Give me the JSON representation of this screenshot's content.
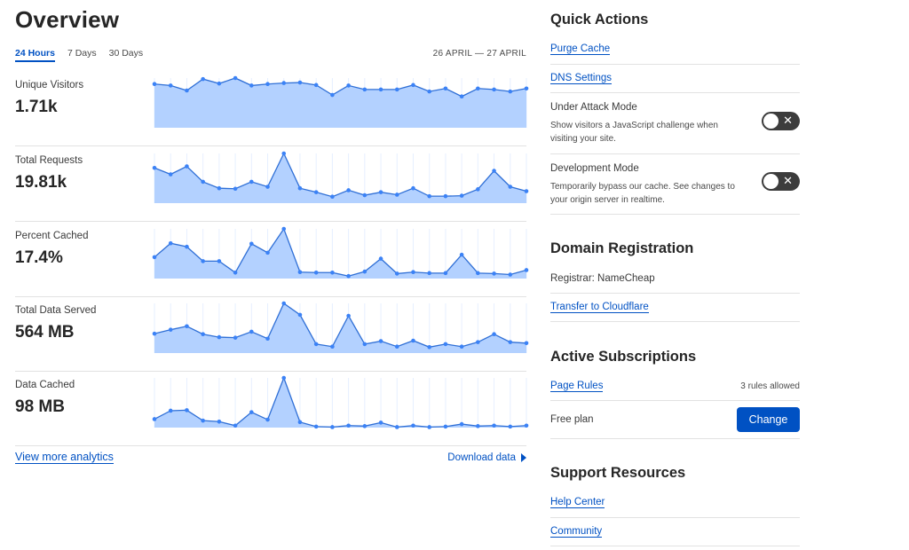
{
  "overview": {
    "title": "Overview",
    "tabs": [
      {
        "label": "24 Hours",
        "active": true
      },
      {
        "label": "7 Days",
        "active": false
      },
      {
        "label": "30 Days",
        "active": false
      }
    ],
    "date_range": "26 APRIL — 27 APRIL",
    "metrics": [
      {
        "label": "Unique Visitors",
        "value": "1.71k"
      },
      {
        "label": "Total Requests",
        "value": "19.81k"
      },
      {
        "label": "Percent Cached",
        "value": "17.4%"
      },
      {
        "label": "Total Data Served",
        "value": "564 MB"
      },
      {
        "label": "Data Cached",
        "value": "98 MB"
      }
    ],
    "view_more_label": "View more analytics",
    "download_label": "Download data",
    "colors": {
      "line": "#3b82f6",
      "fill": "#b3d1ff",
      "grid": "#e6efff"
    }
  },
  "chart_data": [
    {
      "type": "area",
      "title": "Unique Visitors",
      "x": [
        1,
        2,
        3,
        4,
        5,
        6,
        7,
        8,
        9,
        10,
        11,
        12,
        13,
        14,
        15,
        16,
        17,
        18,
        19,
        20,
        21,
        22,
        23,
        24
      ],
      "values": [
        88,
        85,
        75,
        98,
        89,
        100,
        85,
        88,
        90,
        91,
        86,
        66,
        85,
        77,
        77,
        77,
        86,
        73,
        79,
        63,
        79,
        77,
        73,
        79
      ],
      "ylim": [
        0,
        100
      ]
    },
    {
      "type": "area",
      "title": "Total Requests",
      "x": [
        1,
        2,
        3,
        4,
        5,
        6,
        7,
        8,
        9,
        10,
        11,
        12,
        13,
        14,
        15,
        16,
        17,
        18,
        19,
        20,
        21,
        22,
        23,
        24
      ],
      "values": [
        71,
        58,
        74,
        43,
        30,
        29,
        43,
        33,
        100,
        30,
        22,
        13,
        26,
        16,
        22,
        17,
        30,
        14,
        14,
        15,
        28,
        65,
        33,
        24
      ],
      "ylim": [
        0,
        100
      ]
    },
    {
      "type": "area",
      "title": "Percent Cached",
      "x": [
        1,
        2,
        3,
        4,
        5,
        6,
        7,
        8,
        9,
        10,
        11,
        12,
        13,
        14,
        15,
        16,
        17,
        18,
        19,
        20,
        21,
        22,
        23,
        24
      ],
      "values": [
        43,
        71,
        64,
        35,
        35,
        12,
        70,
        52,
        100,
        13,
        12,
        12,
        5,
        14,
        40,
        10,
        13,
        11,
        11,
        48,
        11,
        10,
        8,
        17
      ],
      "ylim": [
        0,
        100
      ]
    },
    {
      "type": "area",
      "title": "Total Data Served",
      "x": [
        1,
        2,
        3,
        4,
        5,
        6,
        7,
        8,
        9,
        10,
        11,
        12,
        13,
        14,
        15,
        16,
        17,
        18,
        19,
        20,
        21,
        22,
        23,
        24
      ],
      "values": [
        39,
        47,
        54,
        38,
        32,
        31,
        43,
        29,
        100,
        77,
        18,
        13,
        75,
        18,
        24,
        13,
        25,
        12,
        18,
        13,
        22,
        38,
        22,
        20
      ],
      "ylim": [
        0,
        100
      ]
    },
    {
      "type": "area",
      "title": "Data Cached",
      "x": [
        1,
        2,
        3,
        4,
        5,
        6,
        7,
        8,
        9,
        10,
        11,
        12,
        13,
        14,
        15,
        16,
        17,
        18,
        19,
        20,
        21,
        22,
        23,
        24
      ],
      "values": [
        17,
        34,
        35,
        14,
        12,
        4,
        31,
        16,
        100,
        11,
        2,
        1,
        4,
        3,
        10,
        1,
        4,
        1,
        2,
        7,
        3,
        4,
        2,
        4
      ],
      "ylim": [
        0,
        100
      ]
    }
  ],
  "quick_actions": {
    "title": "Quick Actions",
    "purge_cache": "Purge Cache",
    "dns_settings": "DNS Settings",
    "under_attack": {
      "title": "Under Attack Mode",
      "desc": "Show visitors a JavaScript challenge when visiting your site.",
      "enabled": false
    },
    "development": {
      "title": "Development Mode",
      "desc": "Temporarily bypass our cache. See changes to your origin server in realtime.",
      "enabled": false
    },
    "toggle_off_glyph": "✕"
  },
  "domain_registration": {
    "title": "Domain Registration",
    "registrar": "Registrar: NameCheap",
    "transfer": "Transfer to Cloudflare"
  },
  "subscriptions": {
    "title": "Active Subscriptions",
    "page_rules": "Page Rules",
    "page_rules_note": "3 rules allowed",
    "plan": "Free plan",
    "change_label": "Change"
  },
  "support": {
    "title": "Support Resources",
    "help_center": "Help Center",
    "community": "Community"
  }
}
